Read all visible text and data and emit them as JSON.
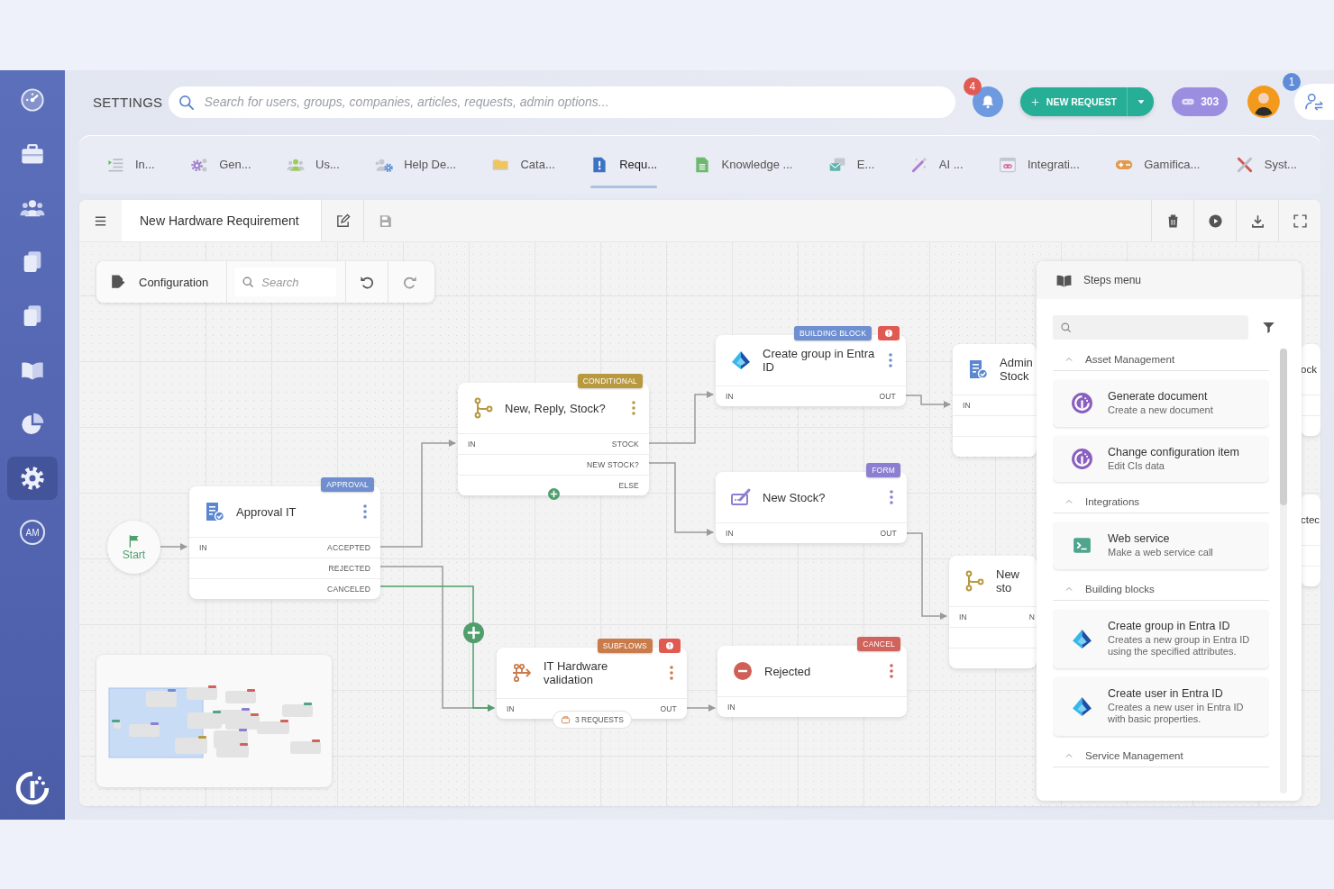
{
  "sidebar": {
    "items": [
      {
        "selected": false
      },
      {
        "selected": false
      },
      {
        "selected": false
      },
      {
        "selected": false
      },
      {
        "selected": false
      },
      {
        "selected": false
      },
      {
        "selected": false
      },
      {
        "selected": true
      },
      {
        "label": "AM",
        "selected": false
      }
    ]
  },
  "header": {
    "title": "SETTINGS",
    "search": {
      "placeholder": "Search for users, groups, companies, articles, requests, admin options..."
    },
    "notifications": {
      "count": "4"
    },
    "new_request": {
      "label": "NEW REQUEST"
    },
    "points": {
      "value": "303"
    },
    "profile": {
      "count": "1"
    }
  },
  "tabs": [
    {
      "label": "In...",
      "selected": false
    },
    {
      "label": "Gen...",
      "selected": false
    },
    {
      "label": "Us...",
      "selected": false
    },
    {
      "label": "Help De...",
      "selected": false
    },
    {
      "label": "Cata...",
      "selected": false
    },
    {
      "label": "Requ...",
      "selected": true
    },
    {
      "label": "Knowledge ...",
      "selected": false
    },
    {
      "label": "E...",
      "selected": false
    },
    {
      "label": "AI ...",
      "selected": false
    },
    {
      "label": "Integrati...",
      "selected": false
    },
    {
      "label": "Gamifica...",
      "selected": false
    },
    {
      "label": "Syst...",
      "selected": false
    }
  ],
  "editor": {
    "title": "New Hardware Requirement",
    "save": {
      "disabled": true
    }
  },
  "canvas_toolbar": {
    "label": "Configuration",
    "search": {
      "placeholder": "Search"
    },
    "redo": {
      "disabled": true
    }
  },
  "nodes": [
    {
      "kind": "start",
      "title": "Start"
    },
    {
      "kind": "step",
      "title": "Approval IT",
      "tag": "APPROVAL",
      "color": "#6f8fd0",
      "error": false,
      "ports": [
        {
          "in": "IN",
          "out": "ACCEPTED"
        },
        {
          "out": "REJECTED"
        },
        {
          "out": "CANCELED"
        }
      ]
    },
    {
      "kind": "step",
      "title": "New, Reply, Stock?",
      "tag": "CONDITIONAL",
      "color": "#b8993f",
      "error": false,
      "ports": [
        {
          "in": "IN",
          "out": "STOCK"
        },
        {
          "out": "NEW STOCK?"
        },
        {
          "out": "ELSE"
        }
      ]
    },
    {
      "kind": "step",
      "title": "Create group in Entra ID",
      "tag": "BUILDING BLOCK",
      "color": "#6f8fd0",
      "error": true,
      "ports": [
        {
          "in": "IN",
          "out": "OUT"
        }
      ]
    },
    {
      "kind": "step",
      "title": "Admin Stock",
      "error": false,
      "ports": [
        {
          "in": "IN"
        }
      ]
    },
    {
      "kind": "step",
      "title": "New Stock?",
      "tag": "FORM",
      "color": "#8c7fd2",
      "error": false,
      "ports": [
        {
          "in": "IN",
          "out": "OUT"
        }
      ]
    },
    {
      "kind": "step",
      "title": "New sto",
      "error": false,
      "ports": [
        {
          "in": "IN",
          "out": "N"
        }
      ]
    },
    {
      "kind": "step",
      "title": "IT Hardware validation",
      "tag": "SUBFLOWS",
      "color": "#c97b4b",
      "error": true,
      "chip": "3 REQUESTS",
      "ports": [
        {
          "in": "IN",
          "out": "OUT"
        }
      ]
    },
    {
      "kind": "step",
      "title": "Rejected",
      "tag": "CANCEL",
      "color": "#d0635b",
      "error": false,
      "ports": [
        {
          "in": "IN"
        }
      ]
    },
    {
      "kind": "partial",
      "title": "ock"
    },
    {
      "kind": "partial",
      "title": "ctec"
    }
  ],
  "steps_menu": {
    "title": "Steps menu",
    "sections": [
      {
        "title": "Asset Management",
        "expanded": true,
        "items": [
          {
            "title": "Generate document",
            "description": "Create a new document"
          },
          {
            "title": "Change configuration item",
            "description": "Edit CIs data"
          }
        ]
      },
      {
        "title": "Integrations",
        "expanded": true,
        "items": [
          {
            "title": "Web service",
            "description": "Make a web service call"
          }
        ]
      },
      {
        "title": "Building blocks",
        "expanded": true,
        "items": [
          {
            "title": "Create group in Entra ID",
            "description": "Creates a new group in Entra ID using the specified attributes."
          },
          {
            "title": "Create user in Entra ID",
            "description": "Creates a new user in Entra ID with basic properties."
          }
        ]
      },
      {
        "title": "Service Management",
        "expanded": true
      }
    ]
  }
}
